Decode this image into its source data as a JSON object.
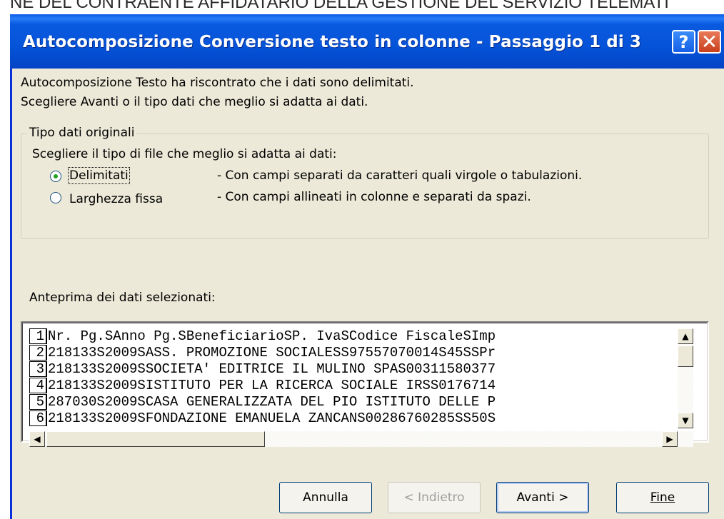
{
  "background": {
    "header_text": "NE DEL CONTRAENTE AFFIDATARIO DELLA GESTIONE DEL SERVIZIO TELEMATI"
  },
  "dialog": {
    "title": "Autocomposizione Conversione testo in colonne - Passaggio 1 di 3",
    "intro_line1": "Autocomposizione Testo ha riscontrato che i dati sono delimitati.",
    "intro_line2": "Scegliere Avanti o il tipo dati che meglio si adatta ai dati."
  },
  "original_type": {
    "legend": "Tipo dati originali",
    "prompt": "Scegliere il tipo di file che meglio si adatta ai dati:",
    "options": [
      {
        "label": "Delimitati",
        "desc": "- Con campi separati da caratteri quali virgole o tabulazioni.",
        "selected": true
      },
      {
        "label": "Larghezza fissa",
        "desc": "- Con campi allineati in colonne e separati da spazi.",
        "selected": false
      }
    ]
  },
  "preview": {
    "label": "Anteprima dei dati selezionati:",
    "rows": [
      {
        "num": "1",
        "text": "Nr. Pg.SAnno Pg.SBeneficiarioSP. IvaSCodice FiscaleSImp"
      },
      {
        "num": "2",
        "text": "218133S2009SASS. PROMOZIONE SOCIALESS97557070014S45SSPr"
      },
      {
        "num": "3",
        "text": "218133S2009SSOCIETA' EDITRICE IL MULINO SPAS00311580377"
      },
      {
        "num": "4",
        "text": "218133S2009SISTITUTO PER LA RICERCA SOCIALE IRSS0176714"
      },
      {
        "num": "5",
        "text": "287030S2009SCASA GENERALIZZATA DEL PIO ISTITUTO DELLE P"
      },
      {
        "num": "6",
        "text": "218133S2009SFONDAZIONE EMANUELA ZANCANS00286760285SS50S"
      }
    ]
  },
  "buttons": {
    "cancel": "Annulla",
    "back": "< Indietro",
    "next": "Avanti >",
    "finish": "Fine"
  },
  "colors": {
    "titlebar": "#0553d8",
    "dialog_bg": "#ece9d8",
    "close_button": "#c8401c",
    "radio_dot": "#21a121"
  }
}
